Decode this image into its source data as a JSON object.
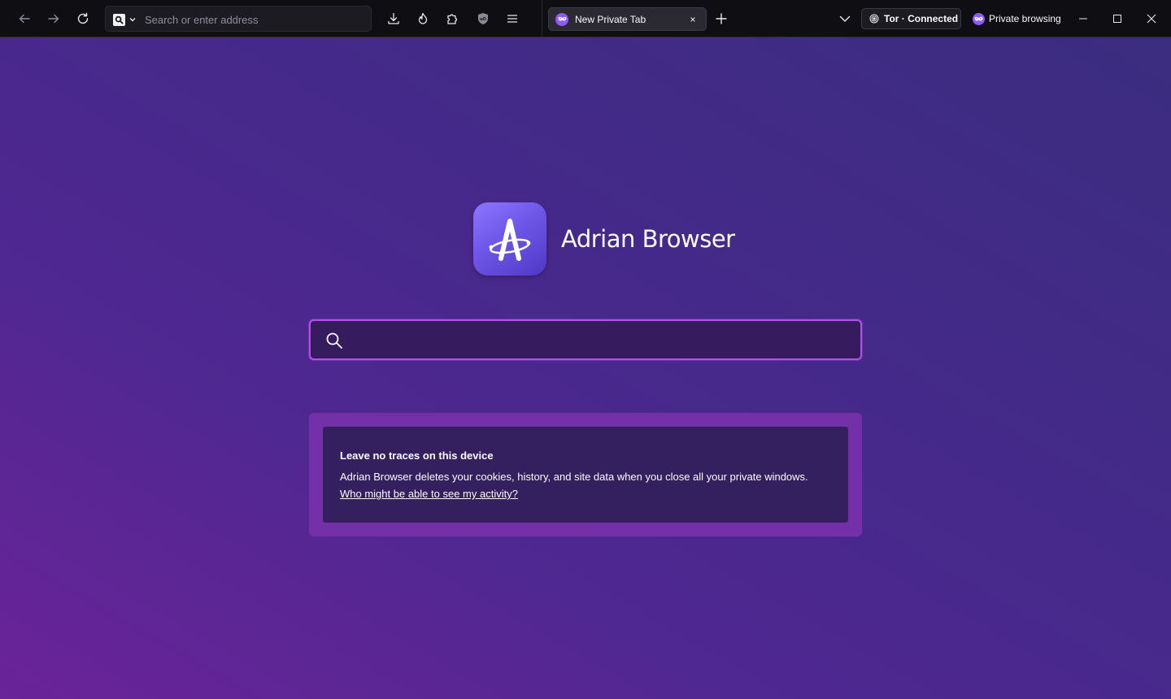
{
  "toolbar": {
    "back_icon": "back-arrow-icon",
    "forward_icon": "forward-arrow-icon",
    "reload_icon": "reload-icon",
    "url_placeholder": "Search or enter address",
    "downloads_icon": "download-icon",
    "fire_icon": "forget-fire-icon",
    "extensions_icon": "puzzle-piece-icon",
    "ublock_icon": "ublock-shield-icon",
    "menu_icon": "hamburger-menu-icon"
  },
  "tabs": [
    {
      "label": "New Private Tab",
      "icon": "private-mask-icon",
      "close": "×"
    }
  ],
  "tor_status": "Tor · Connected",
  "private_indicator": "Private browsing",
  "window_controls": [
    "minimize",
    "maximize",
    "close"
  ],
  "main": {
    "brand_name": "Adrian Browser",
    "search_placeholder": "",
    "info": {
      "title": "Leave no traces on this device",
      "body": "Adrian Browser deletes your cookies, history, and site data when you close all your private windows.",
      "link": "Who might be able to see my activity?"
    }
  },
  "colors": {
    "accent": "#9059ff",
    "search_border": "#b150e8",
    "info_outer": "#7430a8",
    "info_inner": "#34205e"
  }
}
